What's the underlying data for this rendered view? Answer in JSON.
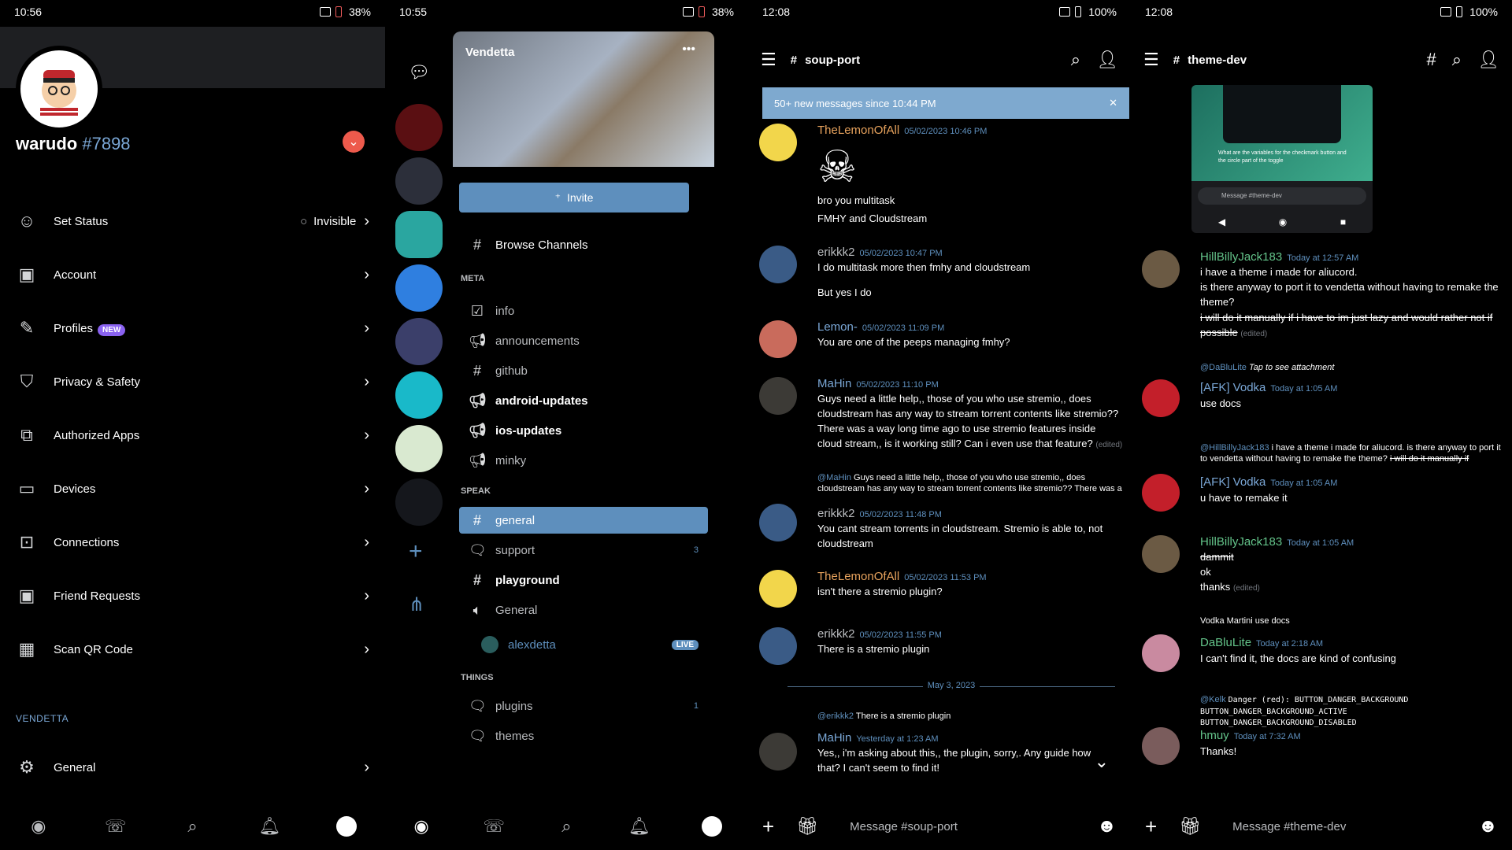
{
  "p1": {
    "time": "10:56",
    "battery": "38%",
    "username": "warudo",
    "discriminator": "#7898",
    "items": [
      {
        "label": "Set Status",
        "icon": "status-icon",
        "value": "Invisible"
      },
      {
        "label": "Account",
        "icon": "account-icon"
      },
      {
        "label": "Profiles",
        "icon": "pencil-icon",
        "badge": "NEW"
      },
      {
        "label": "Privacy & Safety",
        "icon": "shield-icon"
      },
      {
        "label": "Authorized Apps",
        "icon": "apps-icon"
      },
      {
        "label": "Devices",
        "icon": "monitor-icon"
      },
      {
        "label": "Connections",
        "icon": "connections-icon"
      },
      {
        "label": "Friend Requests",
        "icon": "friend-icon"
      },
      {
        "label": "Scan QR Code",
        "icon": "qr-icon"
      }
    ],
    "section": "VENDETTA",
    "general": "General"
  },
  "p2": {
    "time": "10:55",
    "battery": "38%",
    "guild_name": "Vendetta",
    "invite": "Invite",
    "browse": "Browse Channels",
    "cat_meta": "META",
    "cat_speak": "SPEAK",
    "cat_things": "THINGS",
    "ch": {
      "info": "info",
      "announcements": "announcements",
      "github": "github",
      "android": "android-updates",
      "ios": "ios-updates",
      "minky": "minky",
      "general": "general",
      "support": "support",
      "support_count": "3",
      "playground": "playground",
      "voice_general": "General",
      "voice_user": "alexdetta",
      "live": "LIVE",
      "plugins": "plugins",
      "plugins_count": "1",
      "themes": "themes"
    }
  },
  "p3": {
    "time": "12:08",
    "battery": "100%",
    "channel": "soup-port",
    "newbar": "50+ new messages since 10:44 PM",
    "messages": [
      {
        "author": "TheLemonOfAll",
        "ts": "05/02/2023 10:46 PM",
        "body1": "bro you multitask",
        "body2": "FMHY and Cloudstream"
      },
      {
        "author": "erikkk2",
        "ts": "05/02/2023 10:47 PM",
        "body1": "I do multitask more then fmhy and cloudstream",
        "body2": "But yes I do"
      },
      {
        "author": "Lemon-",
        "ts": "05/02/2023 11:09 PM",
        "body1": "You are one of the peeps managing fmhy?"
      },
      {
        "author": "MaHin",
        "ts": "05/02/2023 11:10 PM",
        "body1": "Guys need a little help,,  those of you who use stremio,,  does cloudstream has any way to stream torrent contents like stremio?? There was a way long time ago to use stremio features inside cloud stream,, is it working still? Can i even use that feature?",
        "edited": "(edited)"
      },
      {
        "reply_to": "@MaHin",
        "reply_text": "Guys need a little help,,  those of you who use stremio,,  does cloudstream has any way to stream torrent contents like stremio?? There was a",
        "author": "erikkk2",
        "ts": "05/02/2023 11:48 PM",
        "body1": "You cant stream torrents in cloudstream. Stremio is able to, not cloudstream"
      },
      {
        "author": "TheLemonOfAll",
        "ts": "05/02/2023 11:53 PM",
        "body1": "isn't there a stremio plugin?"
      },
      {
        "author": "erikkk2",
        "ts": "05/02/2023 11:55 PM",
        "body1": "There is a stremio plugin"
      },
      {
        "reply_to": "@erikkk2",
        "reply_text": "There is a stremio plugin",
        "author": "MaHin",
        "ts": "Yesterday at 1:23 AM",
        "body1": "Yes,, i'm asking about this,, the plugin, sorry,. Any  guide how that?  I can't seem to find it!"
      }
    ],
    "date_sep": "May 3, 2023",
    "placeholder": "Message #soup-port"
  },
  "p4": {
    "time": "12:08",
    "battery": "100%",
    "channel": "theme-dev",
    "thumb_caption": "What are the variables for the checkmark button and the circle part of the toggle",
    "thumb_input": "Message #theme-dev",
    "messages": [
      {
        "author": "HillBillyJack183",
        "ts": "Today at 12:57 AM",
        "body1": "i have a theme i made for aliucord.",
        "body2": "is there anyway to port it to vendetta without having to remake the theme?",
        "strike": "i will do it manually  if i have to im just lazy and would rather not if possible",
        "edited": "(edited)"
      },
      {
        "reply_to": "@DaBluLite",
        "reply_text": "Tap to see attachment",
        "author": "[AFK] Vodka",
        "ts": "Today at 1:05 AM",
        "body1": "use docs"
      },
      {
        "reply_to": "@HillBillyJack183",
        "reply_text": "i have a theme i made for aliucord. is there anyway to port it to vendetta without having to remake the theme?",
        "reply_strike": "i will do it manually  if",
        "author": "[AFK] Vodka",
        "ts": "Today at 1:05 AM",
        "body1": "u have to remake it"
      },
      {
        "author": "HillBillyJack183",
        "ts": "Today at 1:05 AM",
        "strike": "dammit",
        "body1": "ok",
        "body2": "thanks",
        "edited": "(edited)"
      },
      {
        "reply_to": "Vodka Martini",
        "reply_text": "use docs",
        "author": "DaBluLite",
        "ts": "Today at 2:18 AM",
        "body1": "I can't find it, the docs are kind of confusing"
      },
      {
        "reply_to": "@Kelk",
        "reply_text": "Danger (red): BUTTON_DANGER_BACKGROUND",
        "reply_text2": "BUTTON_DANGER_BACKGROUND_ACTIVE BUTTON_DANGER_BACKGROUND_DISABLED",
        "author": "hmuy",
        "ts": "Today at 7:32 AM",
        "body1": "Thanks!"
      }
    ],
    "placeholder": "Message #theme-dev"
  },
  "colors": {
    "accent": "#5e8fbd",
    "orange": "#e8a35d",
    "green": "#64c48a"
  }
}
